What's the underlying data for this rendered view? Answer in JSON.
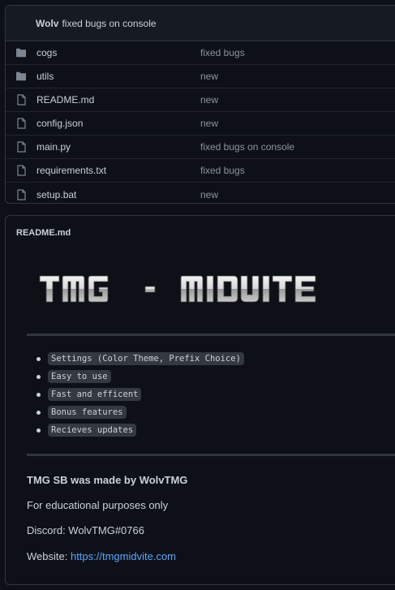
{
  "commit": {
    "author": "Wolv",
    "message": "fixed bugs on console"
  },
  "files": [
    {
      "name": "cogs",
      "type": "folder",
      "icon": "folder-icon",
      "commit": "fixed bugs"
    },
    {
      "name": "utils",
      "type": "folder",
      "icon": "folder-icon",
      "commit": "new"
    },
    {
      "name": "README.md",
      "type": "file",
      "icon": "file-icon",
      "commit": "new"
    },
    {
      "name": "config.json",
      "type": "file",
      "icon": "file-icon",
      "commit": "new"
    },
    {
      "name": "main.py",
      "type": "file",
      "icon": "file-icon",
      "commit": "fixed bugs on console"
    },
    {
      "name": "requirements.txt",
      "type": "file",
      "icon": "file-icon",
      "commit": "fixed bugs"
    },
    {
      "name": "setup.bat",
      "type": "file",
      "icon": "file-icon",
      "commit": "new"
    }
  ],
  "readme": {
    "title": "README.md",
    "logo_text": "TMG - MIDVITE",
    "features": [
      "Settings (Color Theme, Prefix Choice)",
      "Easy to use",
      "Fast and efficent",
      "Bonus features",
      "Recieves updates"
    ],
    "made_by": "TMG SB was made by WolvTMG",
    "purpose": "For educational purposes only",
    "discord": "Discord: WolvTMG#0766",
    "website_label": "Website:",
    "website_url": "https://tmgmidvite.com"
  },
  "colors": {
    "background": "#0d1117",
    "border": "#30363d",
    "text": "#c9d1d9",
    "muted": "#8b949e",
    "link": "#58a6ff",
    "folder": "#7d8590"
  }
}
